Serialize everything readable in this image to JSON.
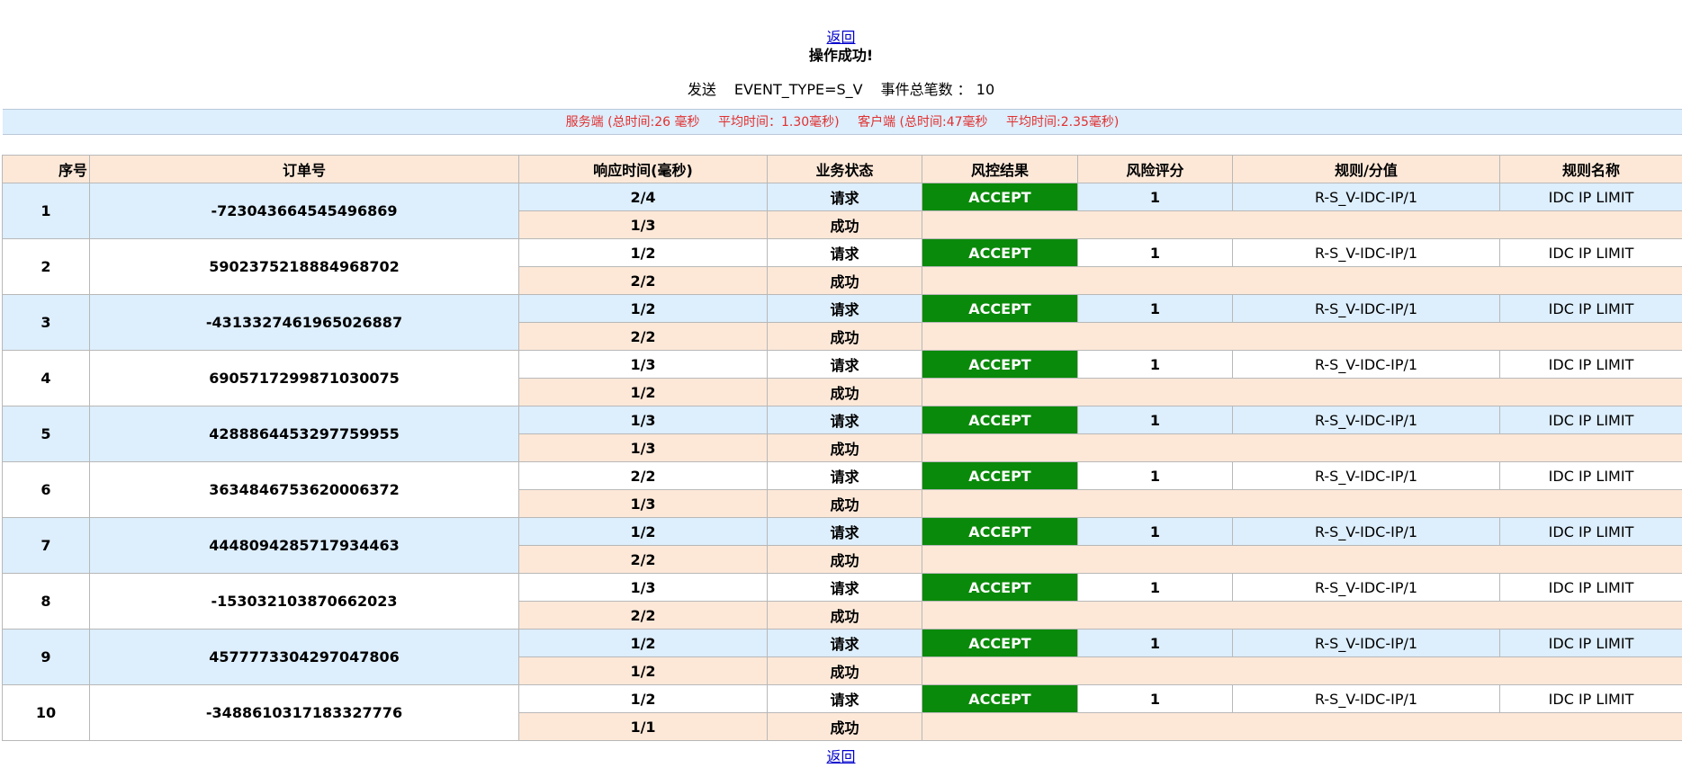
{
  "nav": {
    "back_label": "返回"
  },
  "result": {
    "message": "操作成功!"
  },
  "summary": {
    "send_label": "发送",
    "event_type": "EVENT_TYPE=S_V",
    "total_label": "事件总笔数 ：",
    "total_count": "10"
  },
  "timing": {
    "server": "服务端 (总时间:26 毫秒",
    "server_avg": "平均时间：1.30毫秒)",
    "client": "客户端 (总时间:47毫秒",
    "client_avg": "平均时间:2.35毫秒)"
  },
  "table": {
    "headers": [
      "序号",
      "订单号",
      "响应时间(毫秒)",
      "业务状态",
      "风控结果",
      "风险评分",
      "规则/分值",
      "规则名称"
    ],
    "rows": [
      {
        "no": "1",
        "order": "-723043664545496869",
        "req_time": "2/4",
        "resp_time": "1/3",
        "req_status": "请求",
        "resp_status": "成功",
        "result": "ACCEPT",
        "score": "1",
        "rule": "R-S_V-IDC-IP/1",
        "rule_name": "IDC IP LIMIT"
      },
      {
        "no": "2",
        "order": "5902375218884968702",
        "req_time": "1/2",
        "resp_time": "2/2",
        "req_status": "请求",
        "resp_status": "成功",
        "result": "ACCEPT",
        "score": "1",
        "rule": "R-S_V-IDC-IP/1",
        "rule_name": "IDC IP LIMIT"
      },
      {
        "no": "3",
        "order": "-4313327461965026887",
        "req_time": "1/2",
        "resp_time": "2/2",
        "req_status": "请求",
        "resp_status": "成功",
        "result": "ACCEPT",
        "score": "1",
        "rule": "R-S_V-IDC-IP/1",
        "rule_name": "IDC IP LIMIT"
      },
      {
        "no": "4",
        "order": "6905717299871030075",
        "req_time": "1/3",
        "resp_time": "1/2",
        "req_status": "请求",
        "resp_status": "成功",
        "result": "ACCEPT",
        "score": "1",
        "rule": "R-S_V-IDC-IP/1",
        "rule_name": "IDC IP LIMIT"
      },
      {
        "no": "5",
        "order": "4288864453297759955",
        "req_time": "1/3",
        "resp_time": "1/3",
        "req_status": "请求",
        "resp_status": "成功",
        "result": "ACCEPT",
        "score": "1",
        "rule": "R-S_V-IDC-IP/1",
        "rule_name": "IDC IP LIMIT"
      },
      {
        "no": "6",
        "order": "3634846753620006372",
        "req_time": "2/2",
        "resp_time": "1/3",
        "req_status": "请求",
        "resp_status": "成功",
        "result": "ACCEPT",
        "score": "1",
        "rule": "R-S_V-IDC-IP/1",
        "rule_name": "IDC IP LIMIT"
      },
      {
        "no": "7",
        "order": "4448094285717934463",
        "req_time": "1/2",
        "resp_time": "2/2",
        "req_status": "请求",
        "resp_status": "成功",
        "result": "ACCEPT",
        "score": "1",
        "rule": "R-S_V-IDC-IP/1",
        "rule_name": "IDC IP LIMIT"
      },
      {
        "no": "8",
        "order": "-153032103870662023",
        "req_time": "1/3",
        "resp_time": "2/2",
        "req_status": "请求",
        "resp_status": "成功",
        "result": "ACCEPT",
        "score": "1",
        "rule": "R-S_V-IDC-IP/1",
        "rule_name": "IDC IP LIMIT"
      },
      {
        "no": "9",
        "order": "4577773304297047806",
        "req_time": "1/2",
        "resp_time": "1/2",
        "req_status": "请求",
        "resp_status": "成功",
        "result": "ACCEPT",
        "score": "1",
        "rule": "R-S_V-IDC-IP/1",
        "rule_name": "IDC IP LIMIT"
      },
      {
        "no": "10",
        "order": "-3488610317183327776",
        "req_time": "1/2",
        "resp_time": "1/1",
        "req_status": "请求",
        "resp_status": "成功",
        "result": "ACCEPT",
        "score": "1",
        "rule": "R-S_V-IDC-IP/1",
        "rule_name": "IDC IP LIMIT"
      }
    ]
  },
  "colors": {
    "accept_bg": "#0a8a0a",
    "header_bg": "#fde8d8",
    "stripe_blue": "#ddeefc",
    "timing_text": "#e03030",
    "link": "#0000cc"
  }
}
